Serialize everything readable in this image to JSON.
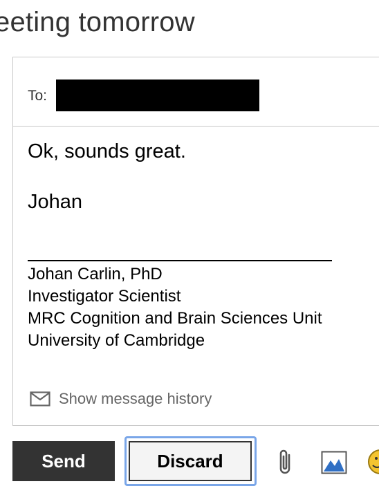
{
  "subject": "eeting tomorrow",
  "compose": {
    "to_label": "To:",
    "body_lines": [
      "Ok, sounds great.",
      "Johan"
    ],
    "signature_rule": "_______________________________",
    "signature": [
      "Johan Carlin, PhD",
      "Investigator Scientist",
      "MRC Cognition and Brain Sciences Unit",
      "University of Cambridge"
    ],
    "history_label": "Show message history",
    "history_icon": "envelope-icon"
  },
  "toolbar": {
    "send_label": "Send",
    "discard_label": "Discard",
    "icons": [
      "attach-icon",
      "image-icon",
      "emoji-icon"
    ],
    "colors": {
      "send_bg": "#333333",
      "focus_ring": "#7aa6e8",
      "image_icon": "#2f6fc4"
    }
  }
}
